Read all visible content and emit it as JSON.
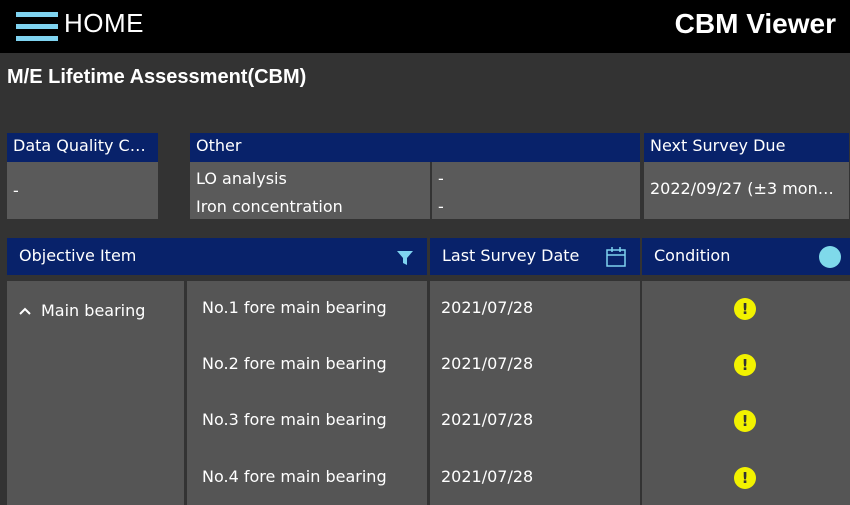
{
  "header": {
    "home_label": "HOME",
    "app_title": "CBM Viewer"
  },
  "page": {
    "title": "M/E Lifetime Assessment(CBM)"
  },
  "summary": {
    "data_quality": {
      "header": "Data Quality Condi…",
      "value": "-"
    },
    "other": {
      "header": "Other",
      "items": [
        {
          "label": "LO analysis",
          "value": "-"
        },
        {
          "label": "Iron concentration",
          "value": "-"
        }
      ]
    },
    "next_survey": {
      "header": "Next Survey Due",
      "value": "2022/09/27 (±3 mon…"
    }
  },
  "table": {
    "columns": {
      "objective": "Objective Item",
      "last_survey": "Last Survey Date",
      "condition": "Condition"
    },
    "group": {
      "label": "Main bearing",
      "rows": [
        {
          "item": "No.1 fore main bearing",
          "date": "2021/07/28",
          "condition": "!"
        },
        {
          "item": "No.2 fore main bearing",
          "date": "2021/07/28",
          "condition": "!"
        },
        {
          "item": "No.3 fore main bearing",
          "date": "2021/07/28",
          "condition": "!"
        },
        {
          "item": "No.4 fore main bearing",
          "date": "2021/07/28",
          "condition": "!"
        }
      ]
    }
  },
  "colors": {
    "header_blue": "#08226a",
    "accent_cyan": "#7fd3f0",
    "warning_yellow": "#f2f200"
  },
  "icons": {
    "menu": "hamburger-icon",
    "filter": "filter-icon",
    "calendar": "calendar-icon",
    "condition": "circle-icon",
    "warning": "exclamation-icon",
    "collapse": "chevron-up-icon"
  }
}
